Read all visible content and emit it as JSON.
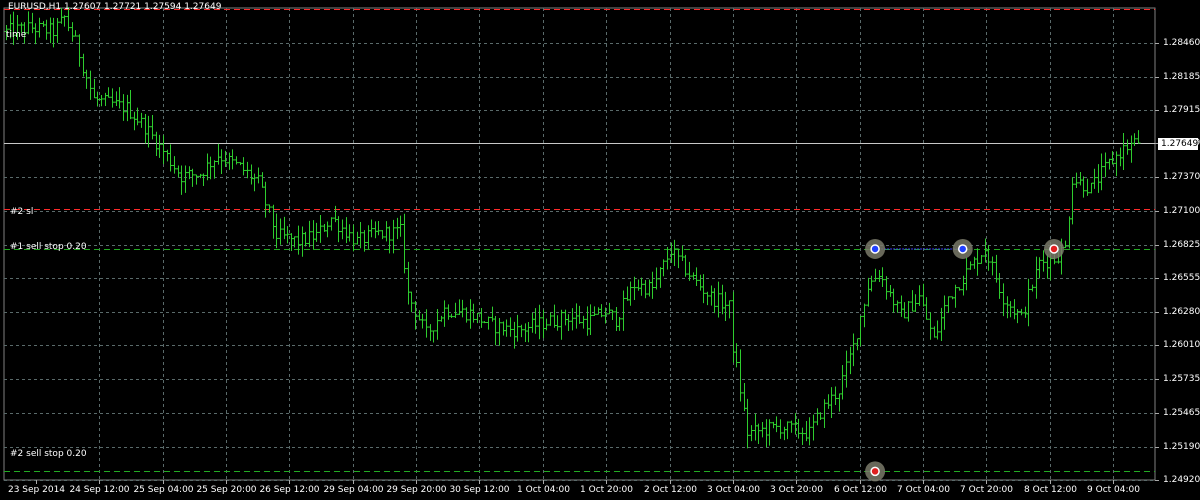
{
  "symbol": {
    "info": "EURUSD,H1  1.27607 1.27721 1.27594 1.27649",
    "time_label": "time"
  },
  "colors": {
    "background": "#000000",
    "candle": "#2ecc2e",
    "grid": "#5a6a6a",
    "stop_loss_line": "#ff2a2a",
    "order_line": "#22aa22",
    "current_price_line": "#c8c8c8",
    "trade_line": "#3c3cff"
  },
  "orders": [
    {
      "label": "#2 sl",
      "price": 1.2711,
      "kind": "sl"
    },
    {
      "label": "#1 sell stop 0.20",
      "price": 1.2679,
      "kind": "order"
    },
    {
      "label": "#2 sell stop 0.20",
      "price": 1.2499,
      "kind": "order"
    }
  ],
  "current_price": "1.27649",
  "y_axis": {
    "range": [
      1.2492,
      1.2874
    ],
    "ticks": [
      "1.28460",
      "1.28185",
      "1.27915",
      "1.27649",
      "1.27370",
      "1.27100",
      "1.26825",
      "1.26555",
      "1.26280",
      "1.26010",
      "1.25735",
      "1.25465",
      "1.25190",
      "1.24920"
    ]
  },
  "x_axis": {
    "labels": [
      "23 Sep 2014",
      "24 Sep 12:00",
      "25 Sep 04:00",
      "25 Sep 20:00",
      "26 Sep 12:00",
      "29 Sep 04:00",
      "29 Sep 20:00",
      "30 Sep 12:00",
      "1 Oct 04:00",
      "1 Oct 20:00",
      "2 Oct 12:00",
      "3 Oct 04:00",
      "3 Oct 20:00",
      "6 Oct 12:00",
      "7 Oct 04:00",
      "7 Oct 20:00",
      "8 Oct 12:00",
      "9 Oct 04:00"
    ]
  },
  "chart_data": {
    "type": "bar",
    "title": "EURUSD,H1",
    "ylim": [
      1.2492,
      1.2874
    ],
    "close_path": [
      [
        0,
        1.2855
      ],
      [
        7,
        1.2858
      ],
      [
        13,
        1.2855
      ],
      [
        16,
        1.2866
      ],
      [
        19,
        1.2846
      ],
      [
        24,
        1.28
      ],
      [
        33,
        1.2793
      ],
      [
        38,
        1.2778
      ],
      [
        44,
        1.2754
      ],
      [
        48,
        1.2738
      ],
      [
        53,
        1.274
      ],
      [
        58,
        1.2755
      ],
      [
        64,
        1.2745
      ],
      [
        69,
        1.2733
      ],
      [
        74,
        1.269
      ],
      [
        80,
        1.2685
      ],
      [
        85,
        1.269
      ],
      [
        89,
        1.2704
      ],
      [
        96,
        1.2685
      ],
      [
        101,
        1.2691
      ],
      [
        108,
        1.2693
      ],
      [
        110,
        1.2642
      ],
      [
        115,
        1.261
      ],
      [
        120,
        1.263
      ],
      [
        127,
        1.2627
      ],
      [
        133,
        1.2617
      ],
      [
        140,
        1.2613
      ],
      [
        148,
        1.262
      ],
      [
        154,
        1.2624
      ],
      [
        159,
        1.262
      ],
      [
        164,
        1.2628
      ],
      [
        167,
        1.2622
      ],
      [
        172,
        1.265
      ],
      [
        177,
        1.2647
      ],
      [
        182,
        1.2678
      ],
      [
        188,
        1.2655
      ],
      [
        193,
        1.264
      ],
      [
        198,
        1.2632
      ],
      [
        199,
        1.26
      ],
      [
        203,
        1.253
      ],
      [
        212,
        1.2535
      ],
      [
        220,
        1.253
      ],
      [
        223,
        1.2547
      ],
      [
        228,
        1.2565
      ],
      [
        232,
        1.26
      ],
      [
        236,
        1.2649
      ],
      [
        239,
        1.266
      ],
      [
        245,
        1.2625
      ],
      [
        250,
        1.264
      ],
      [
        254,
        1.2605
      ],
      [
        258,
        1.264
      ],
      [
        263,
        1.266
      ],
      [
        268,
        1.268
      ],
      [
        273,
        1.264
      ],
      [
        278,
        1.2623
      ],
      [
        283,
        1.2668
      ],
      [
        287,
        1.2671
      ],
      [
        290,
        1.268
      ],
      [
        292,
        1.2736
      ],
      [
        297,
        1.2728
      ],
      [
        302,
        1.2748
      ],
      [
        306,
        1.276
      ],
      [
        310,
        1.2766
      ]
    ],
    "trades": [
      {
        "candle": 238,
        "price": 1.2679,
        "marker": "blue"
      },
      {
        "candle": 262,
        "price": 1.2679,
        "marker": "blue"
      },
      {
        "candle": 287,
        "price": 1.2679,
        "marker": "red"
      },
      {
        "candle": 238,
        "price": 1.2499,
        "marker": "red"
      }
    ],
    "candle_count": 311
  }
}
